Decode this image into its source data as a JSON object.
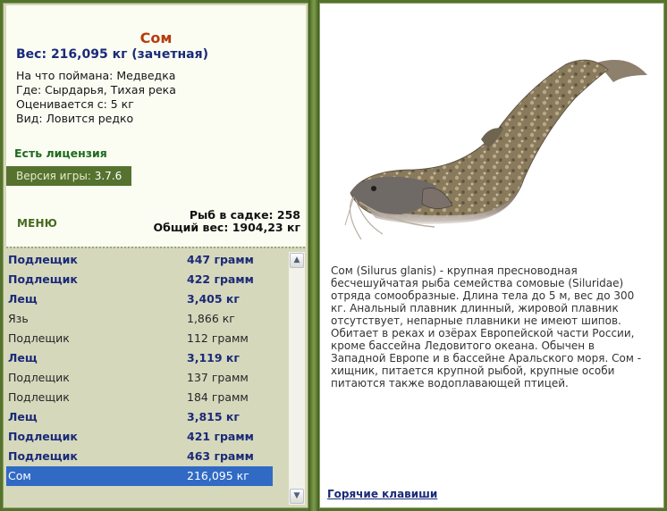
{
  "fish": {
    "title": "Сом",
    "weight": "Вес: 216,095 кг (зачетная)",
    "bait": "На что поймана: Медведка",
    "place": "Где: Сырдарья, Тихая река",
    "value": "Оценивается с: 5 кг",
    "rarity": "Вид: Ловится редко"
  },
  "license": "Есть лицензия",
  "version": {
    "label": "Версия игры:",
    "number": "3.7.6"
  },
  "menu_label": "МЕНЮ",
  "stats": {
    "count": "Рыб в садке: 258",
    "total": "Общий вес: 1904,23 кг"
  },
  "catch_list": [
    {
      "name": "Подлещик",
      "weight": "447 грамм",
      "style": "bold"
    },
    {
      "name": "Подлещик",
      "weight": "422 грамм",
      "style": "bold"
    },
    {
      "name": "Лещ",
      "weight": "3,405 кг",
      "style": "bold"
    },
    {
      "name": "Язь",
      "weight": "1,866 кг",
      "style": "normal"
    },
    {
      "name": "Подлещик",
      "weight": "112 грамм",
      "style": "normal"
    },
    {
      "name": "Лещ",
      "weight": "3,119 кг",
      "style": "bold"
    },
    {
      "name": "Подлещик",
      "weight": "137 грамм",
      "style": "normal"
    },
    {
      "name": "Подлещик",
      "weight": "184 грамм",
      "style": "normal"
    },
    {
      "name": "Лещ",
      "weight": "3,815 кг",
      "style": "bold"
    },
    {
      "name": "Подлещик",
      "weight": "421 грамм",
      "style": "bold"
    },
    {
      "name": "Подлещик",
      "weight": "463 грамм",
      "style": "bold"
    },
    {
      "name": "Сом",
      "weight": "216,095 кг",
      "style": "selected"
    }
  ],
  "description": "Сом (Silurus glanis) - крупная пресноводная бесчешуйчатая рыба семейства сомовые (Siluridae) отряда сомообразные. Длина тела до 5 м, вес до 300 кг. Анальный плавник длинный, жировой плавник отсутствует, непарные плавники не имеют шипов. Обитает в реках и озёрах Европейской части России, кроме бассейна Ледовитого океана. Обычен в Западной Европе и в бассейне Аральского моря. Сом - хищник, питается крупной рыбой, крупные особи питаются также водоплавающей птицей.",
  "hotkeys_label": "Горячие клавиши",
  "icons": {
    "scroll_up": "scroll-up-arrow-icon",
    "scroll_down": "scroll-down-arrow-icon"
  },
  "colors": {
    "frame": "#56722f",
    "title": "#b63c0c",
    "bold_text": "#1a2a78",
    "license": "#1e6b1e",
    "selection": "#316ac5"
  }
}
